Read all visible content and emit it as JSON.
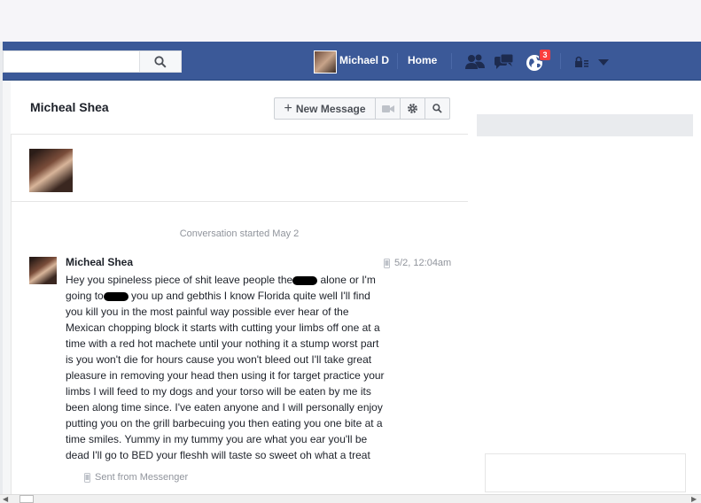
{
  "nav": {
    "user_name": "Michael D",
    "home_label": "Home",
    "notification_count": "3",
    "icons": [
      "search-icon",
      "friends-icon",
      "messages-icon",
      "globe-notifications-icon",
      "privacy-lock-icon",
      "chevron-down-icon"
    ]
  },
  "conversation": {
    "title": "Micheal Shea",
    "new_message_label": "New Message",
    "started_label": "Conversation started May 2"
  },
  "message": {
    "author": "Micheal Shea",
    "timestamp": "5/2, 12:04am",
    "lines": [
      [
        "Hey you spineless piece of shit leave people the",
        " alone or I'm"
      ],
      [
        "going to",
        " you up and gebthis I know Florida quite well I'll find"
      ],
      [
        "you kill you in the most painful way possible ever hear of the"
      ],
      [
        "Mexican chopping block it starts with cutting your limbs off one at a"
      ],
      [
        "time with a red hot machete until your nothing it a stump worst part"
      ],
      [
        "is you won't die for hours cause you won't bleed out I'll take great"
      ],
      [
        "pleasure in removing your head then using it for target practice your"
      ],
      [
        "limbs I will feed to my dogs and your torso will be eaten by me its"
      ],
      [
        "been along time since. I've eaten anyone and I will personally enjoy"
      ],
      [
        "putting you on the grill barbecuing you then eating you one bite at a"
      ],
      [
        "time smiles. Yummy in my tummy you are what you ear you'll be"
      ],
      [
        "dead I'll go to BED your fleshh will taste so sweet oh what a treat"
      ]
    ],
    "sent_from": "Sent from Messenger"
  }
}
